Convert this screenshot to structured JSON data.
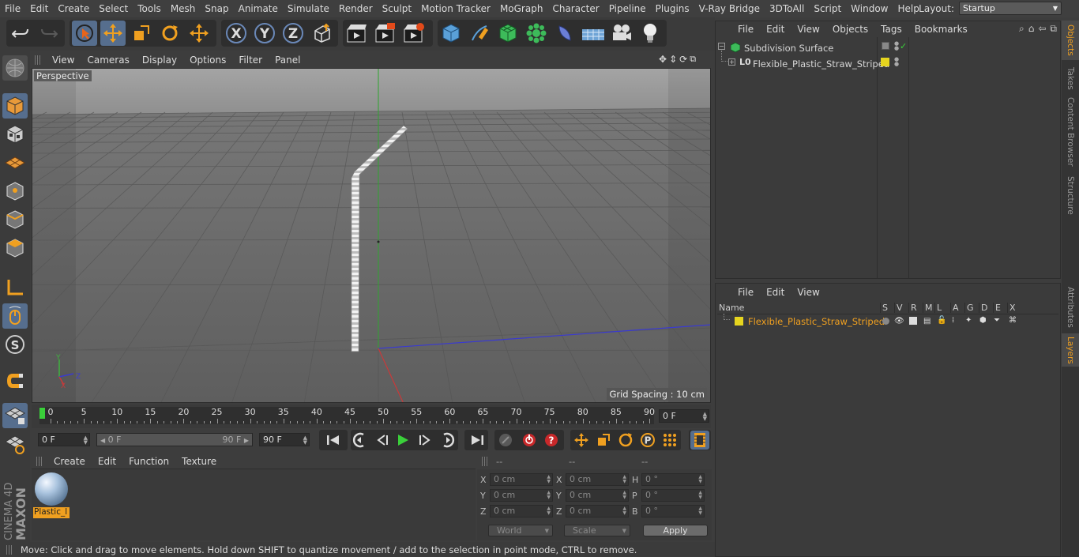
{
  "menubar": {
    "items": [
      "File",
      "Edit",
      "Create",
      "Select",
      "Tools",
      "Mesh",
      "Snap",
      "Animate",
      "Simulate",
      "Render",
      "Sculpt",
      "Motion Tracker",
      "MoGraph",
      "Character",
      "Pipeline",
      "Plugins",
      "V-Ray Bridge",
      "3DToAll",
      "Script",
      "Window",
      "Help"
    ],
    "layout_label": "Layout:",
    "layout_value": "Startup"
  },
  "toolbar": {
    "icons": [
      "undo-icon",
      "redo-icon",
      "live-selection-icon",
      "move-icon",
      "scale-icon",
      "rotate-icon",
      "recent-tool-icon",
      "x-axis-lock-icon",
      "y-axis-lock-icon",
      "z-axis-lock-icon",
      "coordinate-system-icon",
      "render-view-icon",
      "render-picture-viewer-icon",
      "render-settings-icon",
      "cube-icon",
      "pen-icon",
      "subdivision-icon",
      "cloner-icon",
      "deformer-icon",
      "floor-icon",
      "camera-icon",
      "light-icon"
    ],
    "axis_labels": [
      "X",
      "Y",
      "Z"
    ]
  },
  "left_toolbar": {
    "icons": [
      "make-editable-icon",
      "model-mode-icon",
      "texture-mode-icon",
      "workplane-icon",
      "points-mode-icon",
      "edges-mode-icon",
      "polygons-mode-icon",
      "axis-mode-icon",
      "tweak-mode-icon",
      "solo-icon",
      "snap-icon",
      "workplane-lock-icon",
      "locked-workplane-icon"
    ]
  },
  "viewport": {
    "menu": [
      "View",
      "Cameras",
      "Display",
      "Options",
      "Filter",
      "Panel"
    ],
    "label": "Perspective",
    "grid_spacing": "Grid Spacing : 10 cm",
    "axis_gizmo": {
      "y": "Y",
      "z": "Z",
      "x": "X"
    }
  },
  "timeline": {
    "ticks": [
      "0",
      "5",
      "10",
      "15",
      "20",
      "25",
      "30",
      "35",
      "40",
      "45",
      "50",
      "55",
      "60",
      "65",
      "70",
      "75",
      "80",
      "85",
      "90"
    ],
    "current_frame": "0 F",
    "current_frame_position": 0
  },
  "transport": {
    "start_field": "0 F",
    "range_start": "0 F",
    "range_end": "90 F",
    "end_field": "90 F"
  },
  "material_panel": {
    "menu": [
      "Create",
      "Edit",
      "Function",
      "Texture"
    ],
    "materials": [
      {
        "name": "Plastic_l"
      }
    ]
  },
  "coordinates": {
    "headers": [
      "--",
      "--",
      "--"
    ],
    "rows": [
      {
        "l1": "X",
        "v1": "0 cm",
        "l2": "X",
        "v2": "0 cm",
        "l3": "H",
        "v3": "0 °"
      },
      {
        "l1": "Y",
        "v1": "0 cm",
        "l2": "Y",
        "v2": "0 cm",
        "l3": "P",
        "v3": "0 °"
      },
      {
        "l1": "Z",
        "v1": "0 cm",
        "l2": "Z",
        "v2": "0 cm",
        "l3": "B",
        "v3": "0 °"
      }
    ],
    "mode_select": "World",
    "type_select": "Scale",
    "apply_label": "Apply"
  },
  "status": {
    "text": "Move: Click and drag to move elements. Hold down SHIFT to quantize movement / add to the selection in point mode, CTRL to remove."
  },
  "object_manager": {
    "menu": [
      "File",
      "Edit",
      "View",
      "Objects",
      "Tags",
      "Bookmarks"
    ],
    "objects": [
      {
        "name": "Subdivision Surface",
        "color": "#d6d6d6"
      },
      {
        "name": "Flexible_Plastic_Straw_Striped",
        "color": "#d6d6d6"
      }
    ]
  },
  "layer_manager": {
    "menu": [
      "File",
      "Edit",
      "View"
    ],
    "columns": [
      "Name",
      "S",
      "V",
      "R",
      "M",
      "L",
      "A",
      "G",
      "D",
      "E",
      "X"
    ],
    "layers": [
      {
        "name": "Flexible_Plastic_Straw_Striped",
        "color": "#e6d51f",
        "text_color": "#f0a020"
      }
    ]
  },
  "side_tabs": [
    "Objects",
    "Takes",
    "Content Browser",
    "Structure",
    "Attributes",
    "Layers"
  ],
  "branding": {
    "line1": "MAXON",
    "line2": "CINEMA 4D"
  },
  "colors": {
    "accent": "#f0a020",
    "layer_yellow": "#e6d51f",
    "selected_blue": "#4a78b0",
    "x_axis": "#c73a3a",
    "y_axis": "#3fb33f",
    "z_axis": "#3a3ad0"
  }
}
